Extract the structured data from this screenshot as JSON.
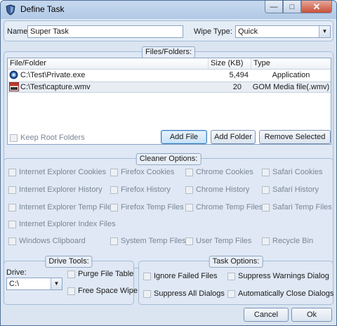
{
  "window": {
    "title": "Define Task",
    "min_icon": "minimize-icon",
    "max_icon": "maximize-icon",
    "close_icon": "close-icon"
  },
  "form": {
    "name_label": "Name:",
    "name_value": "Super Task",
    "wipe_type_label": "Wipe Type:",
    "wipe_type_value": "Quick"
  },
  "files": {
    "legend": "Files/Folders:",
    "columns": [
      "File/Folder",
      "Size (KB)",
      "Type"
    ],
    "rows": [
      {
        "icon": "exe-file-icon",
        "path": "C:\\Test\\Private.exe",
        "size": "5,494",
        "type": "Application"
      },
      {
        "icon": "media-file-icon",
        "path": "C:\\Test\\capture.wmv",
        "size": "20",
        "type": "GOM Media file(.wmv)"
      }
    ],
    "keep_root_label": "Keep Root Folders",
    "add_file_label": "Add File",
    "add_folder_label": "Add Folder",
    "remove_label": "Remove Selected"
  },
  "cleaner": {
    "legend": "Cleaner Options:",
    "options": {
      "ie_cookies": "Internet Explorer Cookies",
      "ff_cookies": "Firefox Cookies",
      "ch_cookies": "Chrome Cookies",
      "sf_cookies": "Safari Cookies",
      "ie_history": "Internet Explorer History",
      "ff_history": "Firefox History",
      "ch_history": "Chrome History",
      "sf_history": "Safari History",
      "ie_temp": "Internet Explorer Temp Files",
      "ff_temp": "Firefox Temp Files",
      "ch_temp": "Chrome Temp Files",
      "sf_temp": "Safari Temp Files",
      "ie_index": "Internet Explorer Index Files",
      "clipboard": "Windows Clipboard",
      "sys_temp": "System Temp Files",
      "user_temp": "User Temp Files",
      "recycle": "Recycle Bin"
    }
  },
  "drive": {
    "legend": "Drive Tools:",
    "drive_label": "Drive:",
    "drive_value": "C:\\",
    "purge_label": "Purge File Table",
    "free_space_label": "Free Space Wipe"
  },
  "task": {
    "legend": "Task Options:",
    "ignore_failed": "Ignore Failed Files",
    "suppress_warnings": "Suppress Warnings Dialog",
    "suppress_all": "Suppress All Dialogs",
    "auto_close": "Automatically Close Dialogs"
  },
  "footer": {
    "cancel_label": "Cancel",
    "ok_label": "Ok"
  }
}
